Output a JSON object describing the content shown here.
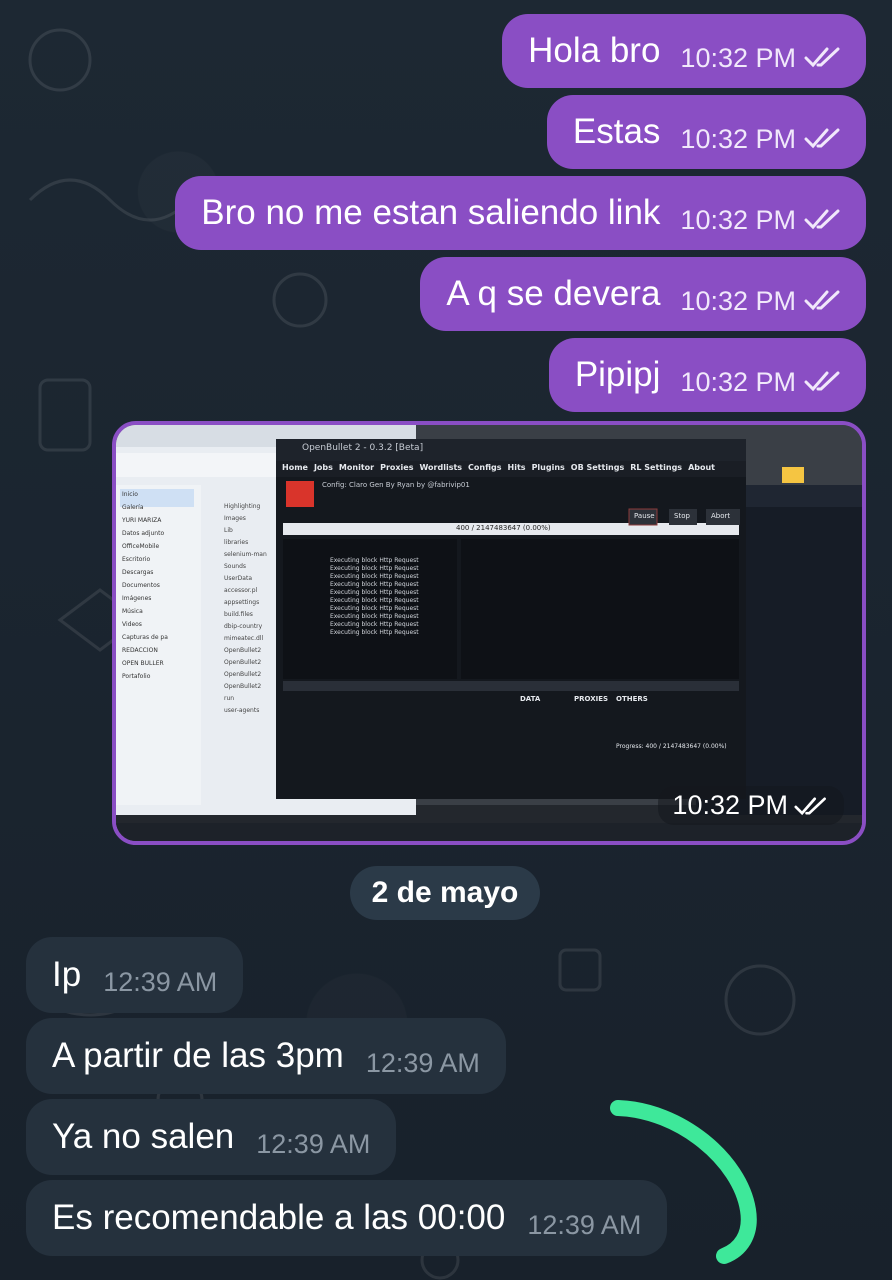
{
  "outgoing_messages": [
    {
      "text": "Hola bro",
      "time": "10:32 PM"
    },
    {
      "text": "Estas",
      "time": "10:32 PM"
    },
    {
      "text": "Bro no me estan saliendo link",
      "time": "10:32 PM"
    },
    {
      "text": "A q se devera",
      "time": "10:32 PM"
    },
    {
      "text": "Pipipj",
      "time": "10:32 PM"
    }
  ],
  "photo_message": {
    "time": "10:32 PM",
    "app": {
      "title": "OpenBullet 2 - 0.3.2 [Beta]",
      "menu": [
        "Home",
        "Jobs",
        "Monitor",
        "Proxies",
        "Wordlists",
        "Configs",
        "Hits",
        "Plugins",
        "OB Settings",
        "RL Settings",
        "About"
      ],
      "config_line": "Config:  Claro Gen By Ryan by @fabrivip01",
      "progress": "400 / 2147483647 (0.00%)",
      "buttons": [
        "Pause",
        "Stop",
        "Abort"
      ],
      "log_row": "Executing block Http Request",
      "data_label": "DATA",
      "proxies_label": "PROXIES",
      "others_label": "OTHERS",
      "progress_line": "Progress:  400 / 2147483647 (0.00%)"
    },
    "explorer": {
      "items": [
        "Inicio",
        "Galería",
        "YURI MARIZA",
        "Datos adjunto",
        "OfficeMobile",
        "Escritorio",
        "Descargas",
        "Documentos",
        "Imágenes",
        "Música",
        "Videos",
        "Capturas de pa",
        "REDACCION",
        "OPEN BULLER",
        "Portafolio"
      ],
      "files": [
        "Highlighting",
        "Images",
        "Lib",
        "libraries",
        "selenium-man",
        "Sounds",
        "UserData",
        "accessor.pl",
        "appsettings",
        "build.files",
        "dbip-country",
        "mimeatec.dll",
        "OpenBullet2",
        "OpenBullet2",
        "OpenBullet2",
        "OpenBullet2",
        "run",
        "user-agents"
      ]
    }
  },
  "date_separator": "2 de mayo",
  "incoming_messages": [
    {
      "text": "Ip",
      "time": "12:39 AM"
    },
    {
      "text": "A partir de las 3pm",
      "time": "12:39 AM"
    },
    {
      "text": "Ya no salen",
      "time": "12:39 AM"
    },
    {
      "text": "Es recomendable a las 00:00",
      "time": "12:39 AM"
    }
  ],
  "colors": {
    "outgoing_bubble": "#8a4ec4",
    "incoming_bubble": "#25313d",
    "background": "#1b2631",
    "annotation_stroke": "#3ee89a"
  }
}
